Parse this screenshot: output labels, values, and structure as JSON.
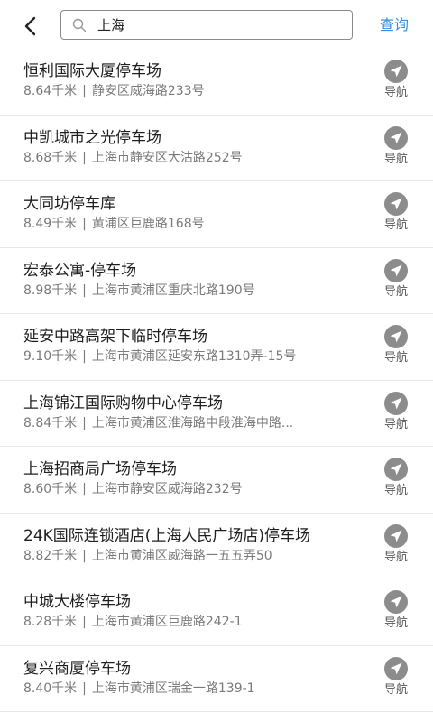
{
  "header": {
    "search": {
      "value": "上海"
    },
    "query_label": "查询"
  },
  "results": [
    {
      "name": "恒利国际大厦停车场",
      "distance": "8.64千米",
      "address": "静安区威海路233号",
      "nav_label": "导航"
    },
    {
      "name": "中凯城市之光停车场",
      "distance": "8.68千米",
      "address": "上海市静安区大沽路252号",
      "nav_label": "导航"
    },
    {
      "name": "大同坊停车库",
      "distance": "8.49千米",
      "address": "黄浦区巨鹿路168号",
      "nav_label": "导航"
    },
    {
      "name": "宏泰公寓-停车场",
      "distance": "8.98千米",
      "address": "上海市黄浦区重庆北路190号",
      "nav_label": "导航"
    },
    {
      "name": "延安中路高架下临时停车场",
      "distance": "9.10千米",
      "address": "上海市黄浦区延安东路1310弄-15号",
      "nav_label": "导航"
    },
    {
      "name": "上海锦江国际购物中心停车场",
      "distance": "8.84千米",
      "address": "上海市黄浦区淮海路中段淮海中路...",
      "nav_label": "导航"
    },
    {
      "name": "上海招商局广场停车场",
      "distance": "8.60千米",
      "address": "上海市静安区威海路232号",
      "nav_label": "导航"
    },
    {
      "name": "24K国际连锁酒店(上海人民广场店)停车场",
      "distance": "8.82千米",
      "address": "上海市黄浦区威海路一五五弄50",
      "nav_label": "导航"
    },
    {
      "name": "中城大楼停车场",
      "distance": "8.28千米",
      "address": "上海市黄浦区巨鹿路242-1",
      "nav_label": "导航"
    },
    {
      "name": "复兴商厦停车场",
      "distance": "8.40千米",
      "address": "上海市黄浦区瑞金一路139-1",
      "nav_label": "导航"
    }
  ],
  "separator": "|",
  "colors": {
    "accent": "#2f8fe0",
    "nav_icon": "#8c8c8c",
    "primary_text": "#1e1e1e",
    "secondary_text": "#7a7a7a"
  },
  "icons": {
    "back": "chevron-left-icon",
    "search": "magnifier-icon",
    "navigate": "navigation-arrow-icon"
  }
}
